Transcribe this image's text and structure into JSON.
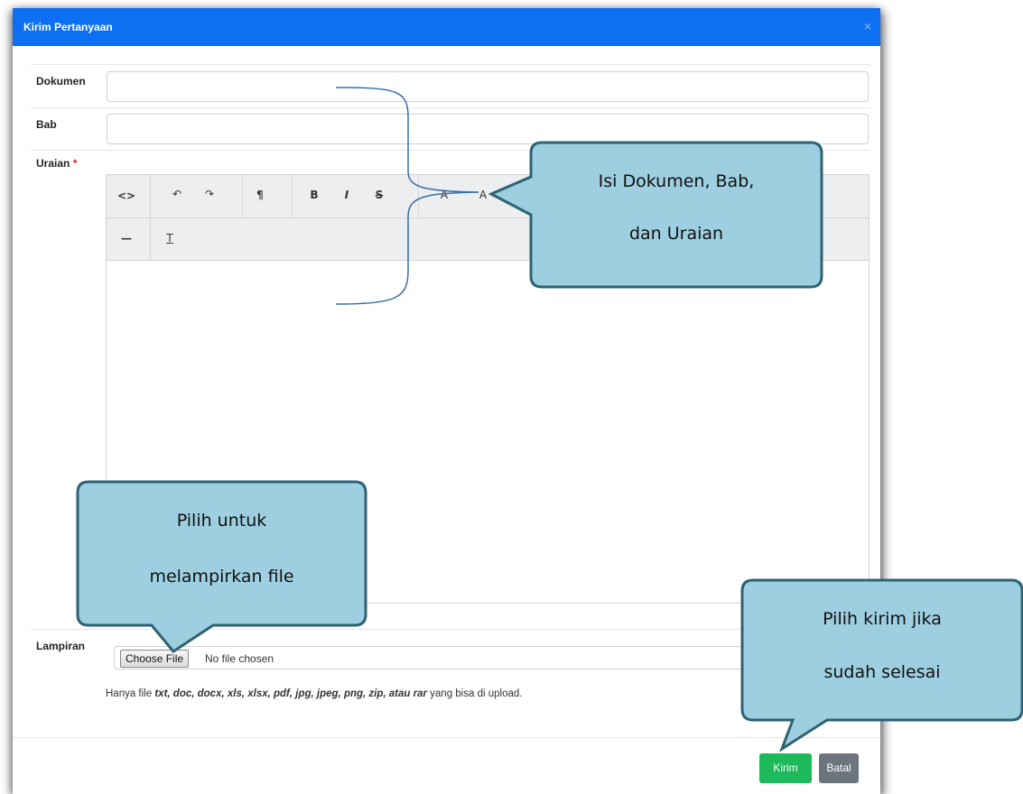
{
  "dialog": {
    "title": "Kirim Pertanyaan",
    "close_glyph": "×"
  },
  "form": {
    "dokumen_label": "Dokumen",
    "bab_label": "Bab",
    "uraian_label": "Uraian",
    "required_mark": "*",
    "lampiran_label": "Lampiran",
    "choose_file_label": "Choose File",
    "file_status": "No file chosen",
    "hint_prefix": "Hanya file ",
    "hint_types": "txt, doc, docx, xls, xlsx, pdf, jpg, jpeg, png, zip, atau rar",
    "hint_suffix": " yang bisa di upload."
  },
  "editor_toolbar": {
    "row1": [
      "<>",
      "↶",
      "↷",
      "¶",
      "B",
      "I",
      "S",
      "A",
      "A"
    ],
    "row2": [
      "—",
      "T"
    ],
    "icons": [
      "code-view-icon",
      "undo-icon",
      "redo-icon",
      "paragraph-icon",
      "bold-icon",
      "italic-icon",
      "strikethrough-icon",
      "superscript-icon",
      "subscript-icon",
      "horizontal-rule-icon",
      "clear-format-icon"
    ]
  },
  "buttons": {
    "kirim": "Kirim",
    "batal": "Batal"
  },
  "callouts": {
    "top_line1": "Isi Dokumen, Bab,",
    "top_line2": "dan Uraian",
    "left_line1": "Pilih untuk",
    "left_line2": "melampirkan file",
    "right_line1": "Pilih kirim jika",
    "right_line2": "sudah selesai"
  },
  "colors": {
    "header": "#0d6ff2",
    "kirim": "#1db95a",
    "batal": "#6c757d",
    "callout_fill": "#9dcfe0",
    "callout_border": "#2d6373",
    "bracket": "#3a6ea5"
  }
}
